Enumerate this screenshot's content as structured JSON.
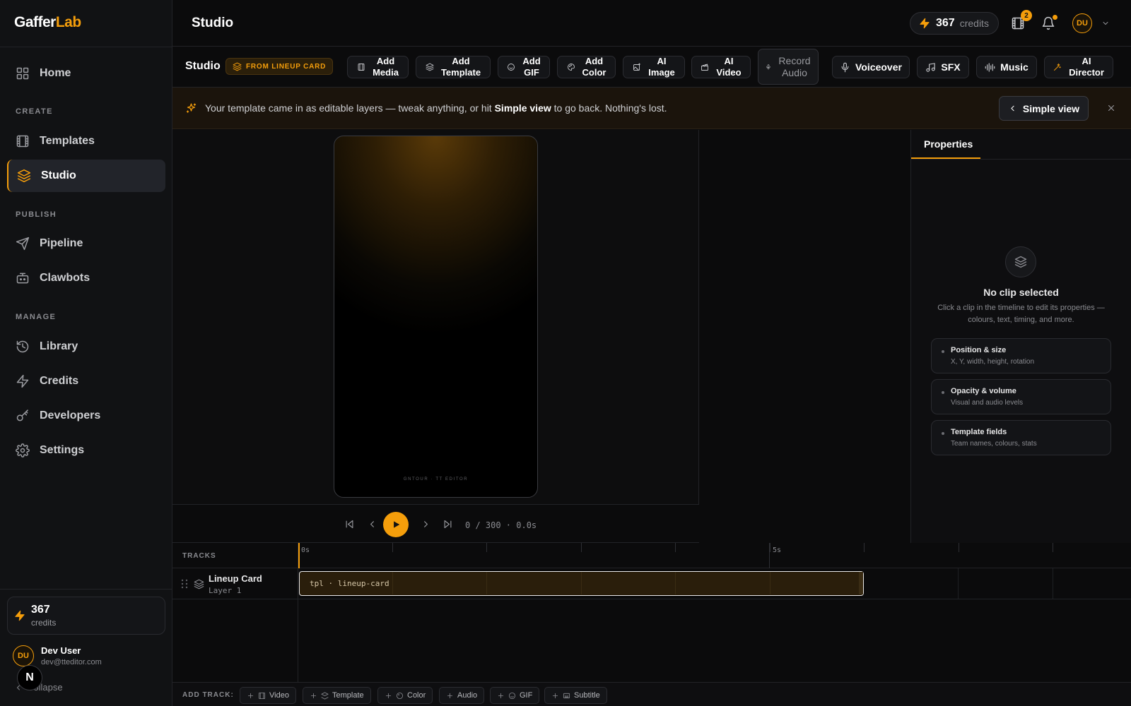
{
  "app": {
    "logo_a": "Gaffer",
    "logo_b": "Lab"
  },
  "sidebar": {
    "items": [
      {
        "label": "Home",
        "icon": "grid-icon"
      },
      {
        "label": "Templates",
        "icon": "film-icon"
      },
      {
        "label": "Studio",
        "icon": "layers-icon",
        "active": true
      },
      {
        "label": "Pipeline",
        "icon": "send-icon"
      },
      {
        "label": "Clawbots",
        "icon": "bot-icon"
      },
      {
        "label": "Library",
        "icon": "history-icon"
      },
      {
        "label": "Credits",
        "icon": "bolt-icon"
      },
      {
        "label": "Developers",
        "icon": "key-icon"
      },
      {
        "label": "Settings",
        "icon": "gear-icon"
      }
    ],
    "sections": {
      "create": "CREATE",
      "publish": "PUBLISH",
      "manage": "MANAGE"
    },
    "credits": {
      "value": "367",
      "label": "credits"
    },
    "user": {
      "initials": "DU",
      "name": "Dev User",
      "email": "dev@tteditor.com"
    },
    "collapse": "Collapse",
    "n_badge": "N"
  },
  "header": {
    "title": "Studio",
    "credits_value": "367",
    "credits_label": "credits",
    "film_badge": "2",
    "avatar": "DU"
  },
  "toolbar": {
    "title": "Studio",
    "badge": "FROM LINEUP CARD",
    "buttons": [
      {
        "l1": "Add",
        "l2": "Media"
      },
      {
        "l1": "Add",
        "l2": "Template"
      },
      {
        "l1": "Add",
        "l2": "GIF"
      },
      {
        "l1": "Add",
        "l2": "Color"
      },
      {
        "l1": "AI",
        "l2": "Image"
      },
      {
        "l1": "AI",
        "l2": "Video"
      },
      {
        "l1": "Record",
        "l2": "Audio"
      },
      {
        "l1": "Voiceover"
      },
      {
        "l1": "SFX"
      },
      {
        "l1": "Music"
      },
      {
        "l1": "AI",
        "l2": "Director"
      }
    ]
  },
  "banner": {
    "text_before": "Your template came in as editable layers — tweak anything, or hit ",
    "text_bold": "Simple view",
    "text_after": " to go back. Nothing's lost.",
    "button": "Simple view"
  },
  "canvas": {
    "footer": "GNTOUR · TT EDITOR"
  },
  "player": {
    "timecode": "0 / 300 · 0.0s"
  },
  "properties": {
    "tab": "Properties",
    "empty_title": "No clip selected",
    "empty_desc": "Click a clip in the timeline to edit its properties — colours, text, timing, and more.",
    "cards": [
      {
        "title": "Position & size",
        "sub": "X, Y, width, height, rotation"
      },
      {
        "title": "Opacity & volume",
        "sub": "Visual and audio levels"
      },
      {
        "title": "Template fields",
        "sub": "Team names, colours, stats"
      }
    ]
  },
  "timeline": {
    "tracks_label": "TRACKS",
    "ruler": {
      "start": "0s",
      "mid": "5s"
    },
    "track": {
      "name": "Lineup Card",
      "sub": "Layer 1"
    },
    "clip_label": "tpl · lineup-card",
    "add_track_label": "ADD TRACK:",
    "add_buttons": [
      "Video",
      "Template",
      "Color",
      "Audio",
      "GIF",
      "Subtitle"
    ]
  }
}
